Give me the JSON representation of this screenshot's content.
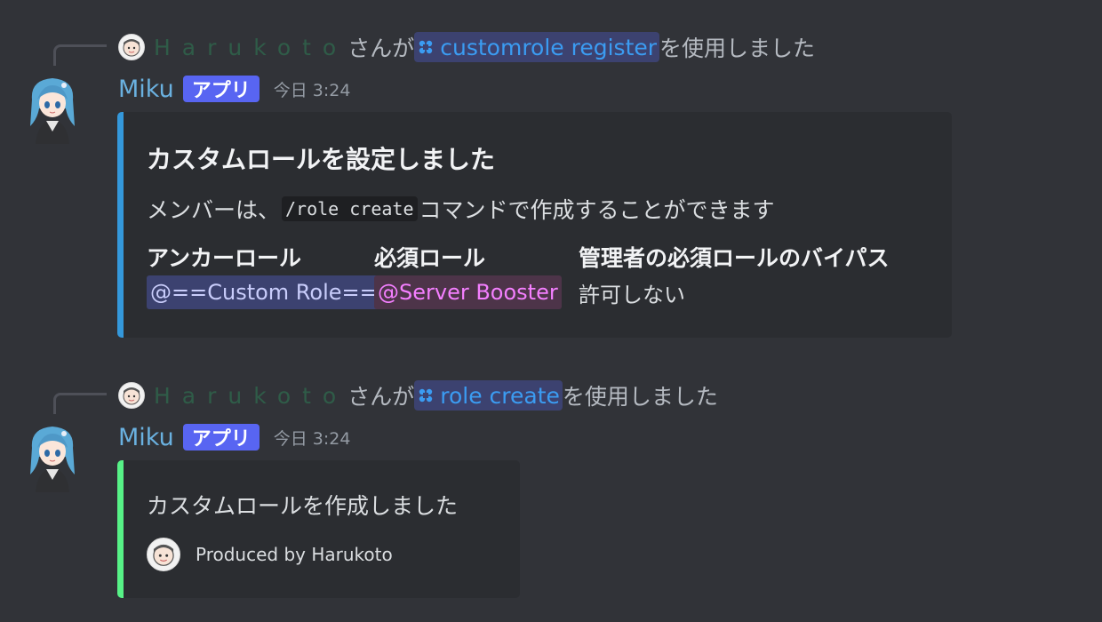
{
  "messages": [
    {
      "reply": {
        "user": "Harukoto",
        "suffix_before": "さんが",
        "command": "customrole register",
        "suffix_after": "を使用しました"
      },
      "author": "Miku",
      "badge": "アプリ",
      "timestamp": "今日 3:24",
      "embed": {
        "color": "#3498db",
        "title": "カスタムロールを設定しました",
        "desc_before": "メンバーは、",
        "desc_code": "/role create",
        "desc_after": "コマンドで作成することができます",
        "fields": [
          {
            "name": "アンカーロール",
            "value": "@==Custom Role=="
          },
          {
            "name": "必須ロール",
            "value": "@Server Booster"
          },
          {
            "name": "管理者の必須ロールのバイパス",
            "value": "許可しない"
          }
        ]
      }
    },
    {
      "reply": {
        "user": "Harukoto",
        "suffix_before": "さんが",
        "command": "role create",
        "suffix_after": "を使用しました"
      },
      "author": "Miku",
      "badge": "アプリ",
      "timestamp": "今日 3:24",
      "embed": {
        "color": "#57f287",
        "text": "カスタムロールを作成しました",
        "footer": "Produced by Harukoto"
      }
    }
  ],
  "colors": {
    "background": "#313338",
    "embed_background": "#2b2d31",
    "mention_blue": "#3b9cf2",
    "author_color": "#6ab1e0",
    "badge_color": "#5865f2",
    "role_booster": "#f47fff"
  }
}
